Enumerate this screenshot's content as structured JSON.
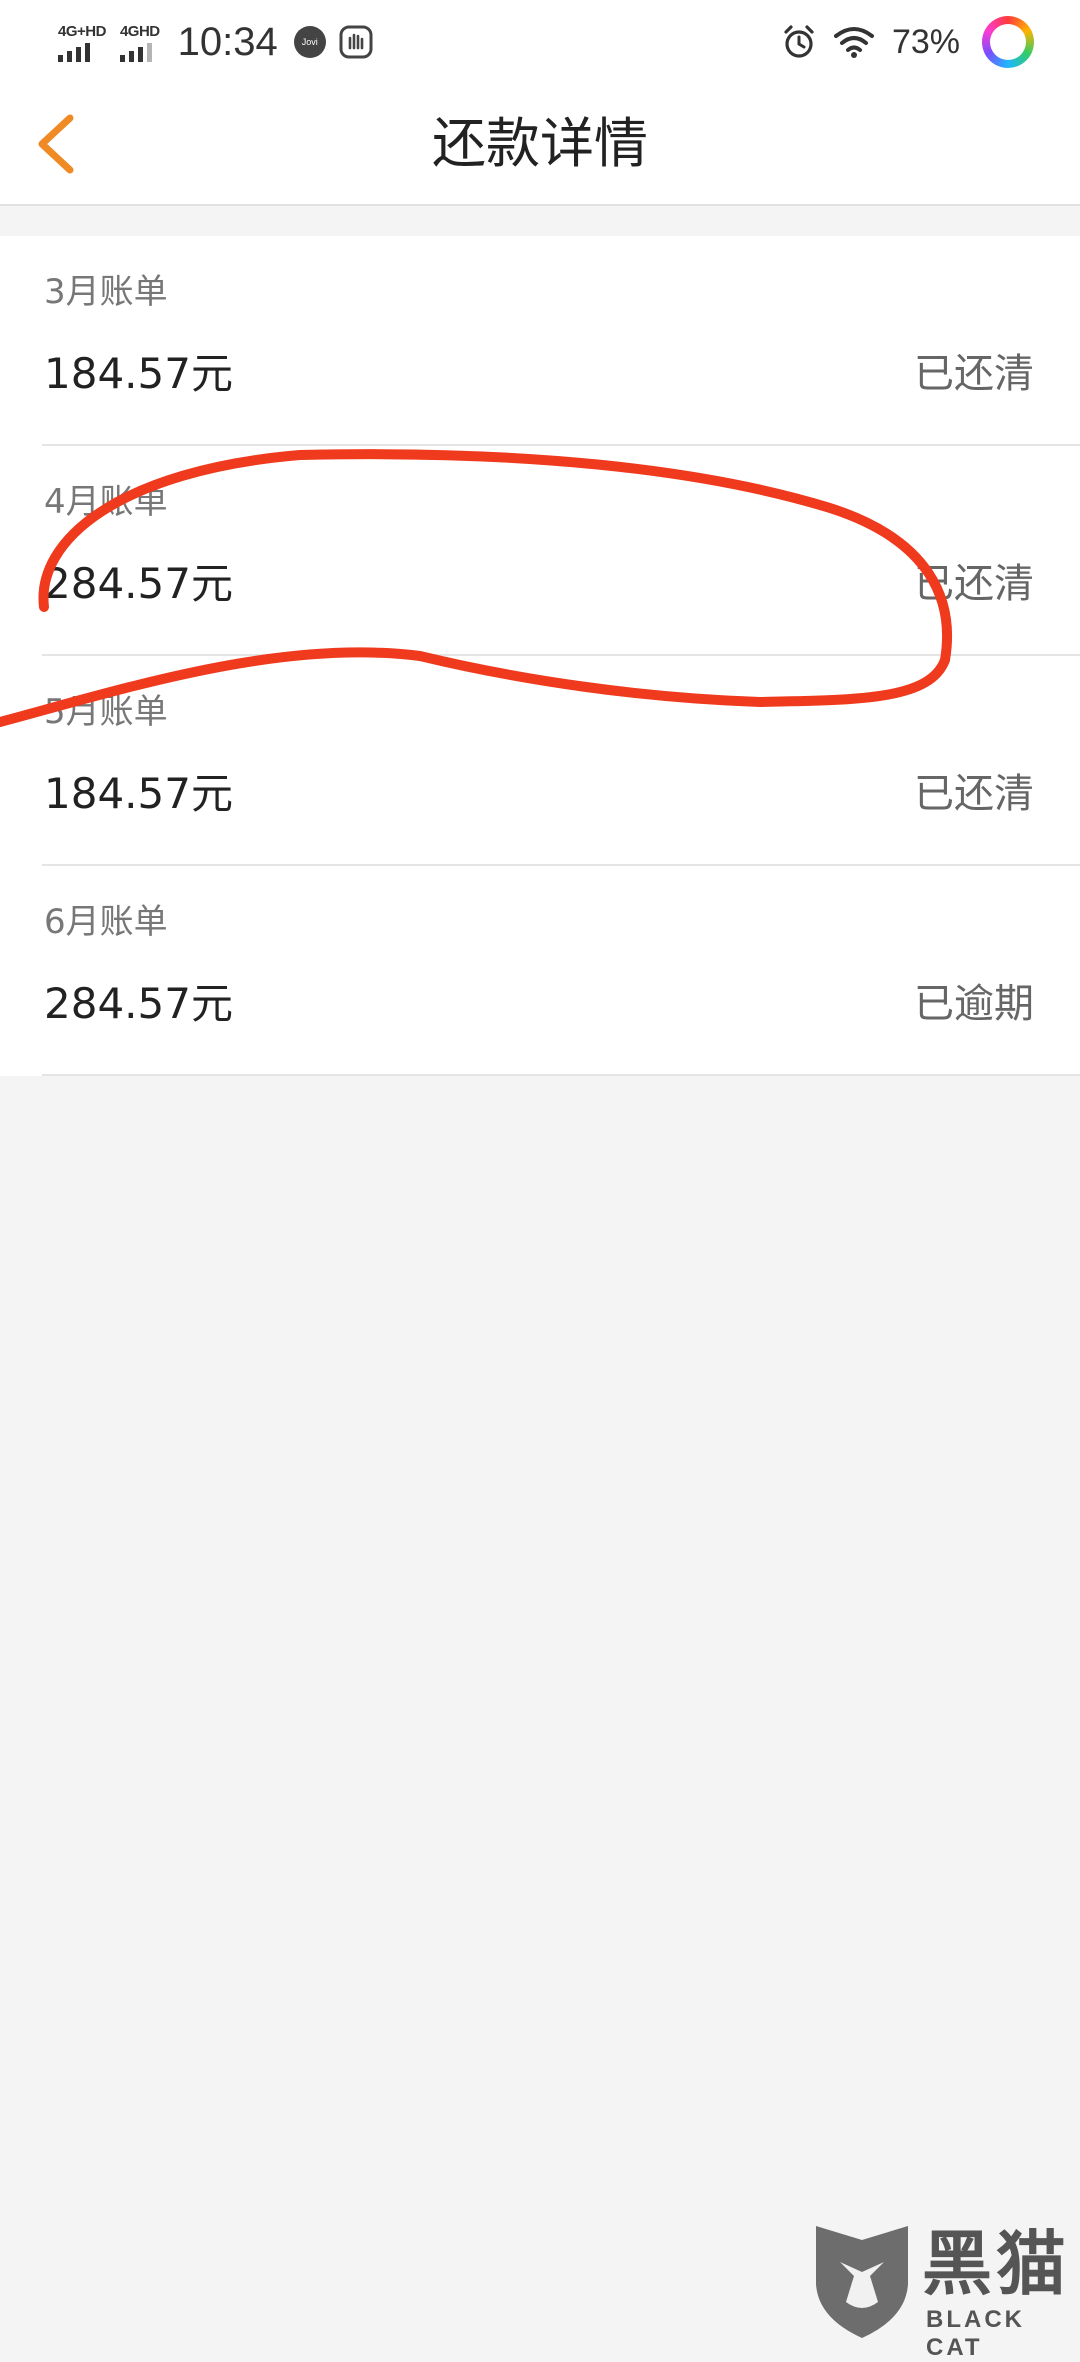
{
  "status_bar": {
    "network1": "4G+HD",
    "network2": "4GHD",
    "time": "10:34",
    "assistant_badge": "Jovi",
    "battery": "73%",
    "icons": [
      "signal-icon",
      "jovi-icon",
      "gesture-hand-icon",
      "alarm-icon",
      "wifi-icon",
      "color-ring-icon"
    ]
  },
  "header": {
    "title": "还款详情",
    "back_icon": "chevron-left-icon",
    "accent_color": "#f08a24"
  },
  "bills": [
    {
      "month": "3月账单",
      "amount": "184.57元",
      "status": "已还清"
    },
    {
      "month": "4月账单",
      "amount": "284.57元",
      "status": "已还清"
    },
    {
      "month": "5月账单",
      "amount": "184.57元",
      "status": "已还清"
    },
    {
      "month": "6月账单",
      "amount": "284.57元",
      "status": "已逾期"
    }
  ],
  "annotation": {
    "color": "#f03a1e"
  },
  "watermark": {
    "title": "黑猫",
    "subtitle": "BLACK CAT"
  }
}
